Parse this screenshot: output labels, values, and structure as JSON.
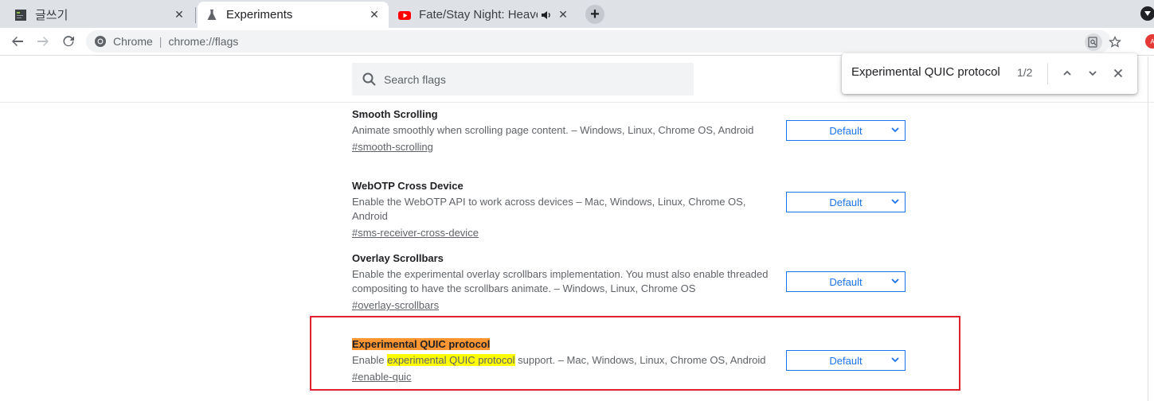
{
  "tabs": [
    {
      "title": "글쓰기",
      "active": false,
      "icon": "document-icon"
    },
    {
      "title": "Experiments",
      "active": true,
      "icon": "flask-icon"
    },
    {
      "title": "Fate/Stay Night: Heaven's Feel",
      "active": false,
      "icon": "youtube-icon",
      "audio": true
    }
  ],
  "tab_close_label": "✕",
  "new_tab_label": "+",
  "omnibox": {
    "site_label": "Chrome",
    "url": "chrome://flags"
  },
  "search": {
    "placeholder": "Search flags"
  },
  "flags": [
    {
      "name": "Smooth Scrolling",
      "description": "Animate smoothly when scrolling page content. – Windows, Linux, Chrome OS, Android",
      "link": "#smooth-scrolling",
      "value": "Default"
    },
    {
      "name": "WebOTP Cross Device",
      "description": "Enable the WebOTP API to work across devices – Mac, Windows, Linux, Chrome OS, Android",
      "link": "#sms-receiver-cross-device",
      "value": "Default"
    },
    {
      "name": "Overlay Scrollbars",
      "description": "Enable the experimental overlay scrollbars implementation. You must also enable threaded compositing to have the scrollbars animate. – Windows, Linux, Chrome OS",
      "link": "#overlay-scrollbars",
      "value": "Default"
    },
    {
      "name": "Experimental QUIC protocol",
      "description_prefix": "Enable ",
      "description_highlight": "experimental QUIC protocol",
      "description_suffix": " support. – Mac, Windows, Linux, Chrome OS, Android",
      "link": "#enable-quic",
      "value": "Default"
    }
  ],
  "find": {
    "query": "Experimental QUIC protocol",
    "count": "1/2"
  },
  "colors": {
    "accent": "#1a73e8",
    "active_match": "#ff9632",
    "match": "#ffff00",
    "annotation_box": "#e0222b"
  }
}
